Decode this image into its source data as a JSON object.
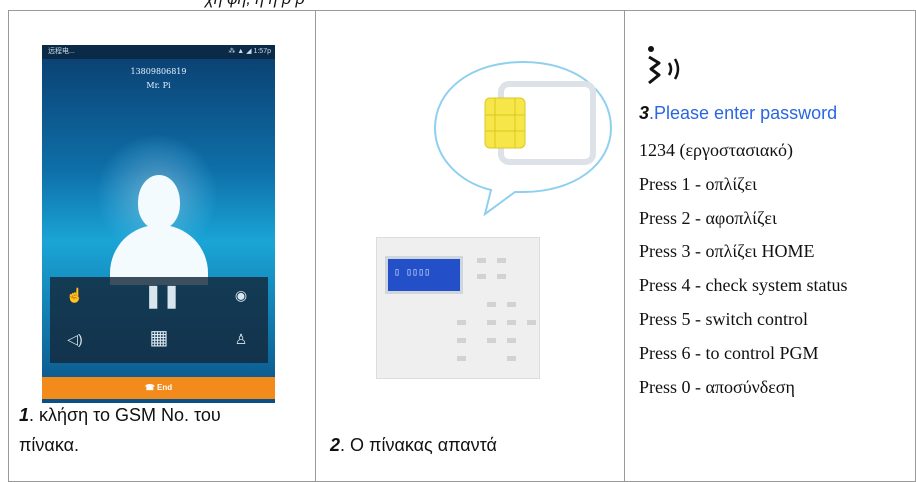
{
  "top_fragment": "χη φή, ή ή ρ ρ",
  "col1": {
    "phone": {
      "status_left": "远程电...",
      "status_right": "⁂ ▲ ◢ 1:57p",
      "number": "13809806819",
      "name": "Mr. Pi",
      "end_label": "☎ End"
    },
    "caption_num": "1",
    "caption_line1": ". κλήση το GSM No. του",
    "caption_line2": "πίνακα."
  },
  "col2": {
    "lcd_text": "▯ ▯▯▯▯",
    "caption_num": "2",
    "caption_text": ". Ο πίνακας απαντά"
  },
  "col3": {
    "step_num": "3",
    "password_prompt": ".Please enter password",
    "lines": [
      "1234 (εργοστασιακό)",
      "Press 1 - οπλίζει",
      "Press 2 - αφοπλίζει",
      "Press 3 - οπλίζει HOME",
      "Press 4 - check system status",
      "Press 5 - switch control",
      "Press 6 - to control PGM",
      "Press 0 - αποσύνδεση"
    ]
  },
  "colors": {
    "link_blue": "#2a66e0",
    "end_orange": "#f28a1c",
    "lcd_blue": "#2350c8"
  }
}
